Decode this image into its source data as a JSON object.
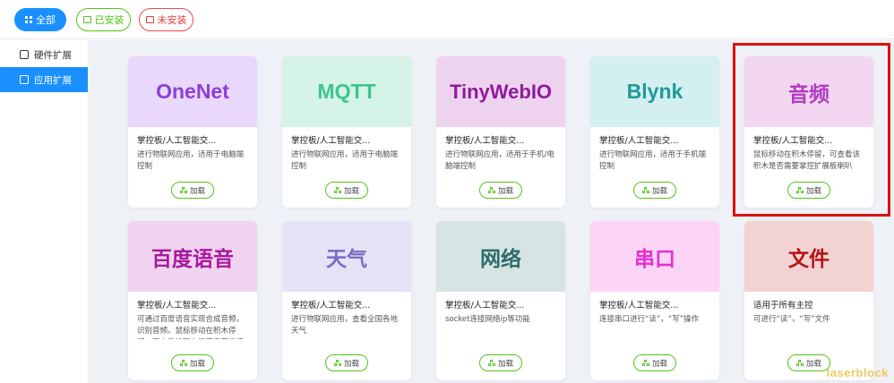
{
  "toolbar": {
    "all_label": "全部",
    "installed_label": "已安装",
    "uninstalled_label": "未安装"
  },
  "sidebar": {
    "items": [
      {
        "label": "硬件扩展",
        "active": false
      },
      {
        "label": "应用扩展",
        "active": true
      }
    ]
  },
  "cards": [
    {
      "title": "OneNet",
      "category": "掌控板/人工智能交...",
      "desc": "进行物联网应用，适用于电脑端控制",
      "button": "加载",
      "title_color": "#8a3fd6",
      "banner_color": "#e9d8fb"
    },
    {
      "title": "MQTT",
      "category": "掌控板/人工智能交...",
      "desc": "进行物联网应用，适用于电脑端控制",
      "button": "加载",
      "title_color": "#3cc68f",
      "banner_color": "#d6f3e7"
    },
    {
      "title": "TinyWebIO",
      "category": "掌控板/人工智能交...",
      "desc": "进行物联网应用，适用于手机/电脑端控制",
      "button": "加载",
      "title_color": "#8e1a9a",
      "banner_color": "#eed3ef"
    },
    {
      "title": "Blynk",
      "category": "掌控板/人工智能交...",
      "desc": "进行物联网应用，适用于手机端控制",
      "button": "加载",
      "title_color": "#1f9a9a",
      "banner_color": "#d3efef"
    },
    {
      "title": "音频",
      "category": "掌控板/人工智能交...",
      "desc": "鼠标移动在积木停留，可查看该积木是否需要掌控扩展板喇叭",
      "button": "加载",
      "title_color": "#b03bbf",
      "banner_color": "#f3d6f0"
    },
    {
      "title": "百度语音",
      "category": "掌控板/人工智能交...",
      "desc": "可通过百度语音实现合成音频，识别音频。鼠标移动在积木停留，可查看该积木是否需要掌控",
      "button": "加载",
      "title_color": "#a8189f",
      "banner_color": "#f0d3ef"
    },
    {
      "title": "天气",
      "category": "掌控板/人工智能交...",
      "desc": "进行物联网应用，查看全国各地天气",
      "button": "加载",
      "title_color": "#7a6ac8",
      "banner_color": "#e7e3f6"
    },
    {
      "title": "网络",
      "category": "掌控板/人工智能交...",
      "desc": "socket连接网络ip等功能",
      "button": "加载",
      "title_color": "#2e6b6b",
      "banner_color": "#d6e5e4"
    },
    {
      "title": "串口",
      "category": "掌控板/人工智能交...",
      "desc": "连接串口进行“读”，“写”操作",
      "button": "加载",
      "title_color": "#e62ed1",
      "banner_color": "#fcd4f6"
    },
    {
      "title": "文件",
      "category": "适用于所有主控",
      "desc": "可进行“读”，“写”文件",
      "button": "加载",
      "title_color": "#b51414",
      "banner_color": "#f3d2d2"
    }
  ],
  "watermark": "laserblock",
  "colors": {
    "accent": "#1a90ff",
    "installed": "#52c41a",
    "uninstalled": "#e04040",
    "highlight": "#e01010"
  }
}
